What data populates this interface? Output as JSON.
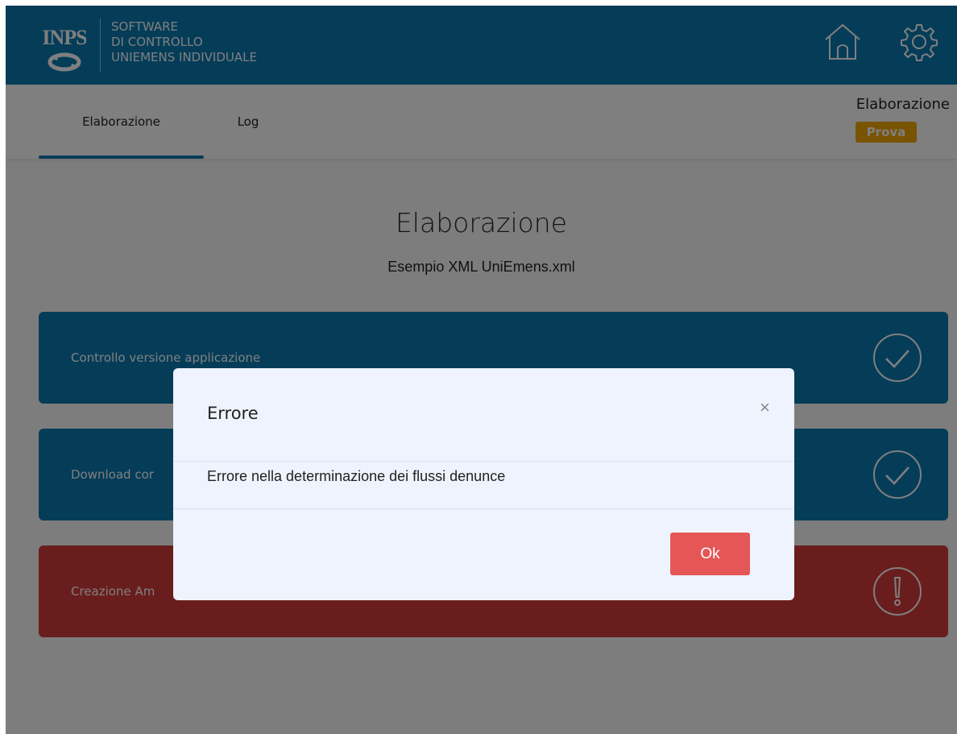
{
  "header": {
    "logo_text": "INPS",
    "title_lines": [
      "SOFTWARE",
      "DI CONTROLLO",
      "UNIEMENS INDIVIDUALE"
    ],
    "icons": [
      "home-icon",
      "gear-icon"
    ]
  },
  "tabs": [
    {
      "label": "Elaborazione",
      "active": true
    },
    {
      "label": "Log",
      "active": false
    }
  ],
  "mode": {
    "label": "Elaborazione",
    "badge": "Prova"
  },
  "main": {
    "title": "Elaborazione",
    "subtitle": "Esempio XML UniEmens.xml",
    "steps": [
      {
        "label": "Controllo versione applicazione",
        "status": "ok",
        "icon": "check-circle-icon"
      },
      {
        "label": "Download cor",
        "status": "ok",
        "icon": "check-circle-icon"
      },
      {
        "label": "Creazione Am",
        "status": "error",
        "icon": "exclamation-circle-icon"
      }
    ]
  },
  "modal": {
    "title": "Errore",
    "close": "×",
    "message": "Errore nella determinazione dei flussi denunce",
    "ok_label": "Ok"
  },
  "colors": {
    "primary": "#0a7bb3",
    "error": "#d53a3a",
    "badge": "#f2a900",
    "ok_button": "#e55656",
    "modal_bg": "#eef3fd"
  }
}
